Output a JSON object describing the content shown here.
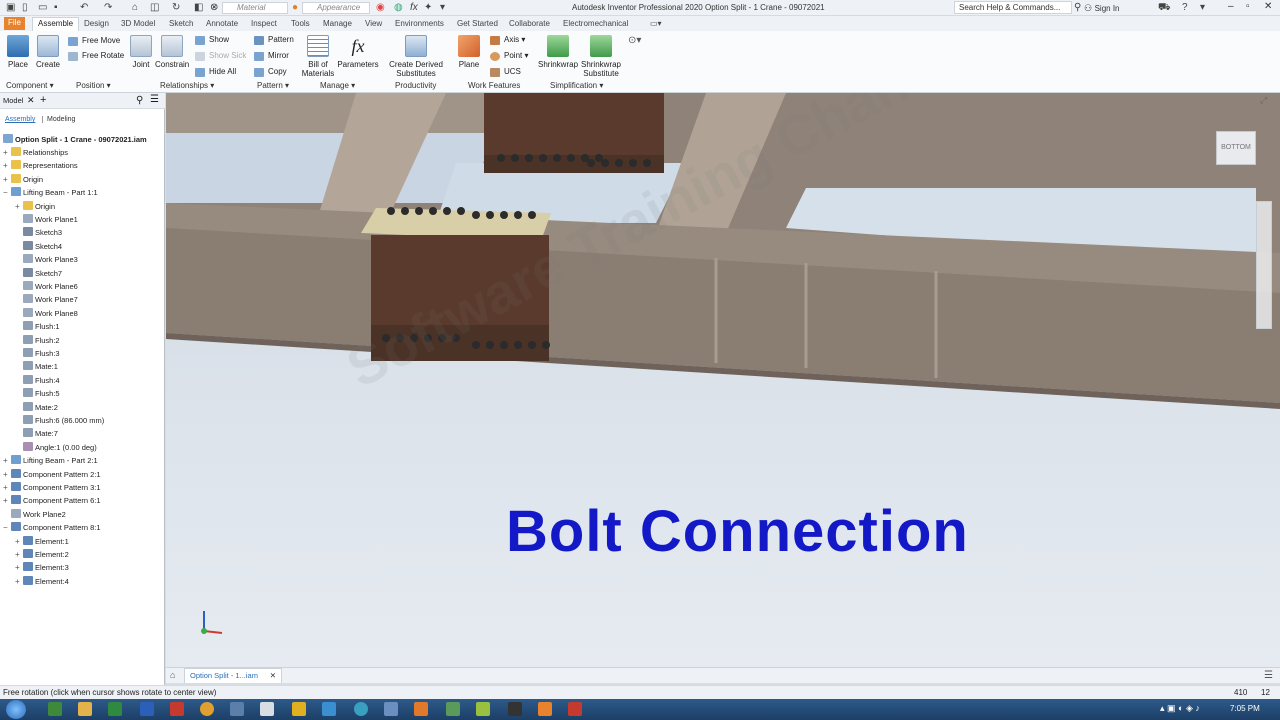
{
  "titlebar": {
    "app_title": "Autodesk Inventor Professional 2020   Option Split - 1 Crane - 09072021",
    "material_label": "Material",
    "appearance_label": "Appearance",
    "help_search_placeholder": "Search Help & Commands...",
    "sign_in": "Sign In"
  },
  "tabs": [
    "File",
    "Assemble",
    "Design",
    "3D Model",
    "Sketch",
    "Annotate",
    "Inspect",
    "Tools",
    "Manage",
    "View",
    "Environments",
    "Get Started",
    "Collaborate",
    "Electromechanical"
  ],
  "ribbon": {
    "component": {
      "place": "Place",
      "create": "Create",
      "panel": "Component ▾"
    },
    "position": {
      "free_move": "Free Move",
      "free_rotate": "Free Rotate",
      "panel": "Position ▾"
    },
    "relationships": {
      "joint": "Joint",
      "constrain": "Constrain",
      "show": "Show",
      "show_sick": "Show Sick",
      "hide_all": "Hide All",
      "panel": "Relationships ▾"
    },
    "pattern": {
      "pattern": "Pattern",
      "mirror": "Mirror",
      "copy": "Copy",
      "panel": "Pattern ▾"
    },
    "manage": {
      "bom": "Bill of Materials",
      "parameters": "Parameters",
      "panel": "Manage ▾"
    },
    "productivity": {
      "create_derived": "Create Derived Substitutes",
      "panel": "Productivity"
    },
    "work_features": {
      "plane": "Plane",
      "axis": "Axis ▾",
      "point": "Point ▾",
      "ucs": "UCS",
      "panel": "Work Features"
    },
    "simplification": {
      "shrinkwrap": "Shrinkwrap",
      "shrinkwrap_sub": "Shrinkwrap Substitute",
      "panel": "Simplification ▾"
    }
  },
  "browser": {
    "tab_model": "Model",
    "mode_assembly": "Assembly",
    "mode_modeling": "Modeling",
    "root": "Option Split - 1 Crane - 09072021.iam",
    "items": [
      {
        "label": "Relationships",
        "indent": 0,
        "toggle": "+",
        "icon": "folder"
      },
      {
        "label": "Representations",
        "indent": 0,
        "toggle": "+",
        "icon": "folder"
      },
      {
        "label": "Origin",
        "indent": 0,
        "toggle": "+",
        "icon": "folder"
      },
      {
        "label": "Lifting Beam - Part 1:1",
        "indent": 0,
        "toggle": "−",
        "icon": "part"
      },
      {
        "label": "Origin",
        "indent": 1,
        "toggle": "+",
        "icon": "folder"
      },
      {
        "label": "Work Plane1",
        "indent": 1,
        "toggle": "",
        "icon": "plane"
      },
      {
        "label": "Sketch3",
        "indent": 1,
        "toggle": "",
        "icon": "sketch"
      },
      {
        "label": "Sketch4",
        "indent": 1,
        "toggle": "",
        "icon": "sketch"
      },
      {
        "label": "Work Plane3",
        "indent": 1,
        "toggle": "",
        "icon": "plane"
      },
      {
        "label": "Sketch7",
        "indent": 1,
        "toggle": "",
        "icon": "sketch"
      },
      {
        "label": "Work Plane6",
        "indent": 1,
        "toggle": "",
        "icon": "plane"
      },
      {
        "label": "Work Plane7",
        "indent": 1,
        "toggle": "",
        "icon": "plane"
      },
      {
        "label": "Work Plane8",
        "indent": 1,
        "toggle": "",
        "icon": "plane"
      },
      {
        "label": "Flush:1",
        "indent": 1,
        "toggle": "",
        "icon": "constraint"
      },
      {
        "label": "Flush:2",
        "indent": 1,
        "toggle": "",
        "icon": "constraint"
      },
      {
        "label": "Flush:3",
        "indent": 1,
        "toggle": "",
        "icon": "constraint"
      },
      {
        "label": "Mate:1",
        "indent": 1,
        "toggle": "",
        "icon": "constraint"
      },
      {
        "label": "Flush:4",
        "indent": 1,
        "toggle": "",
        "icon": "constraint"
      },
      {
        "label": "Flush:5",
        "indent": 1,
        "toggle": "",
        "icon": "constraint"
      },
      {
        "label": "Mate:2",
        "indent": 1,
        "toggle": "",
        "icon": "constraint"
      },
      {
        "label": "Flush:6 (86.000 mm)",
        "indent": 1,
        "toggle": "",
        "icon": "constraint"
      },
      {
        "label": "Mate:7",
        "indent": 1,
        "toggle": "",
        "icon": "constraint"
      },
      {
        "label": "Angle:1 (0.00 deg)",
        "indent": 1,
        "toggle": "",
        "icon": "angle"
      },
      {
        "label": "Lifting Beam - Part 2:1",
        "indent": 0,
        "toggle": "+",
        "icon": "part"
      },
      {
        "label": "Component Pattern 2:1",
        "indent": 0,
        "toggle": "+",
        "icon": "pattern"
      },
      {
        "label": "Component Pattern 3:1",
        "indent": 0,
        "toggle": "+",
        "icon": "pattern"
      },
      {
        "label": "Component Pattern 6:1",
        "indent": 0,
        "toggle": "+",
        "icon": "pattern"
      },
      {
        "label": "Work Plane2",
        "indent": 0,
        "toggle": "",
        "icon": "plane"
      },
      {
        "label": "Component Pattern 8:1",
        "indent": 0,
        "toggle": "−",
        "icon": "pattern"
      },
      {
        "label": "Element:1",
        "indent": 1,
        "toggle": "+",
        "icon": "pattern"
      },
      {
        "label": "Element:2",
        "indent": 1,
        "toggle": "+",
        "icon": "pattern"
      },
      {
        "label": "Element:3",
        "indent": 1,
        "toggle": "+",
        "icon": "pattern"
      },
      {
        "label": "Element:4",
        "indent": 1,
        "toggle": "+",
        "icon": "pattern"
      }
    ]
  },
  "viewport": {
    "overlay_text": "Bolt Connection",
    "watermark": "Software Training Channel",
    "viewcube_label": "BOTTOM"
  },
  "doc_tab": "Option Split - 1...iam",
  "status": {
    "message": "Free rotation (click when cursor shows rotate to center view)",
    "num1": "410",
    "num2": "12"
  },
  "taskbar": {
    "clock": "7:05 PM"
  },
  "colors": {
    "file_tab": "#e8822c",
    "overlay_text": "#1419c8",
    "taskbar": "#1c3f66"
  }
}
